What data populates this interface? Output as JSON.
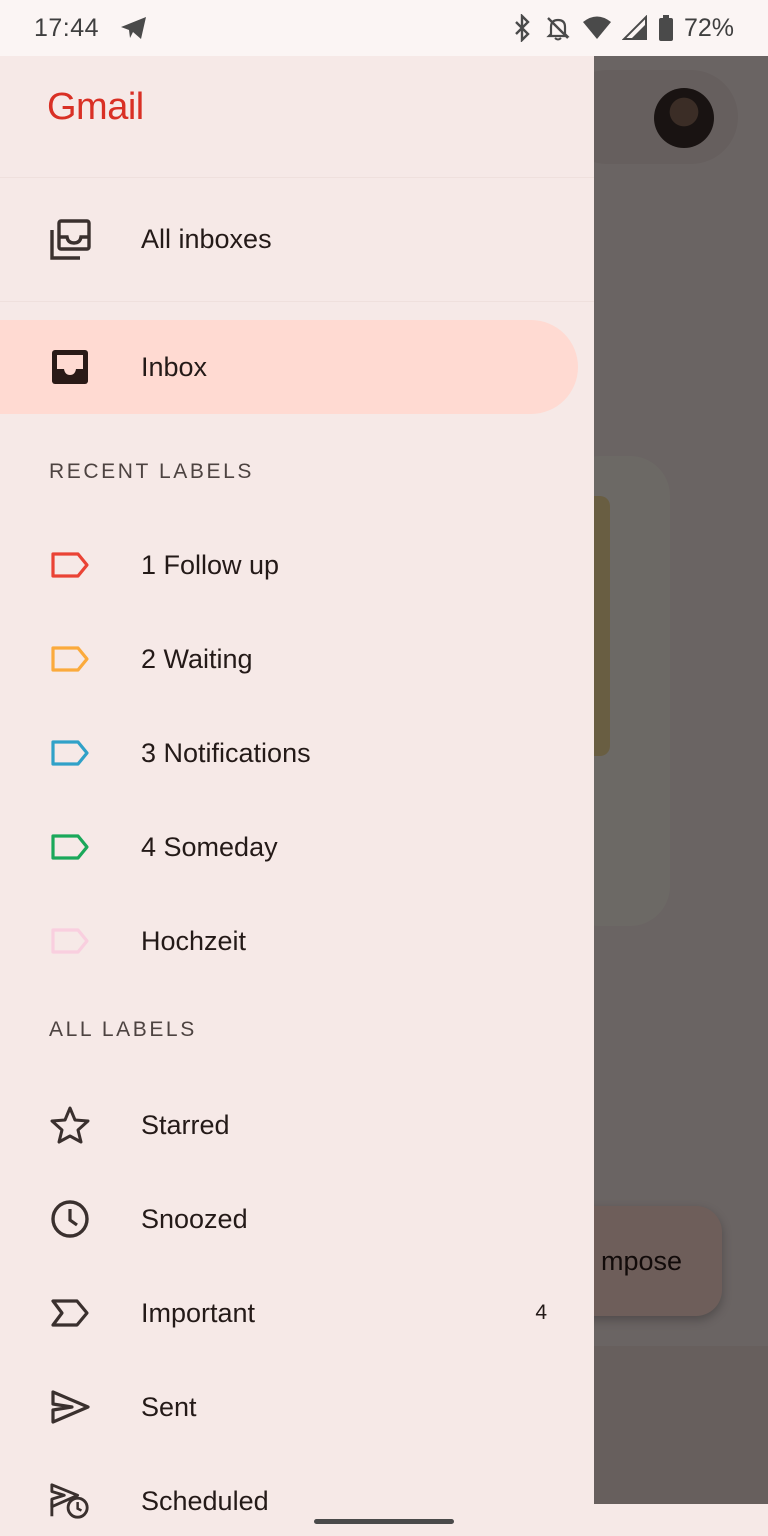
{
  "status_bar": {
    "time": "17:44",
    "battery": "72%"
  },
  "background": {
    "compose_label": "mpose"
  },
  "drawer": {
    "app_name": "Gmail",
    "all_inboxes": "All inboxes",
    "inbox": "Inbox",
    "recent_labels_header": "RECENT LABELS",
    "recent_labels": [
      {
        "label": "1 Follow up",
        "color": "#ea4335"
      },
      {
        "label": "2 Waiting",
        "color": "#fbaa3c"
      },
      {
        "label": "3 Notifications",
        "color": "#30a1c8"
      },
      {
        "label": "4 Someday",
        "color": "#1aa85a"
      },
      {
        "label": "Hochzeit",
        "color": "#f9cfdf"
      }
    ],
    "all_labels_header": "ALL LABELS",
    "all_labels": [
      {
        "label": "Starred",
        "icon": "star-icon"
      },
      {
        "label": "Snoozed",
        "icon": "clock-icon"
      },
      {
        "label": "Important",
        "icon": "important-icon",
        "count": "4"
      },
      {
        "label": "Sent",
        "icon": "send-icon"
      },
      {
        "label": "Scheduled",
        "icon": "scheduled-send-icon"
      }
    ]
  }
}
